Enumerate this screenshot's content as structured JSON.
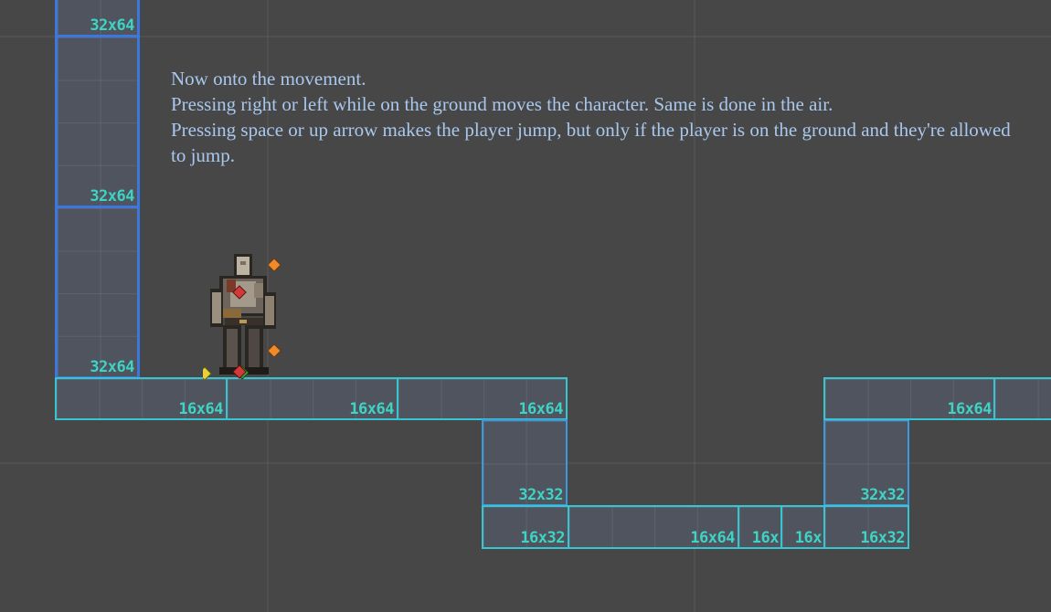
{
  "instructions": {
    "line1": "Now onto the movement.",
    "line2": "Pressing right or left while on the ground moves the character. Same is done in the air.",
    "line3": "Pressing space or up arrow makes the player jump, but only if the player is on the ground and they're allowed to jump."
  },
  "tiles": {
    "wall_top": "32x64",
    "wall_mid": "32x64",
    "wall_bot": "32x64",
    "floor_1": "16x64",
    "floor_2": "16x64",
    "floor_3": "16x64",
    "floor_4": "16x64",
    "pit_left_upper": "32x32",
    "pit_left_lower": "16x32",
    "pit_floor": "16x64",
    "pit_small_1": "16x",
    "pit_small_2": "16x",
    "pit_right_upper": "32x32",
    "pit_right_lower": "16x32"
  },
  "colors": {
    "background": "#474747",
    "wall_border": "#3a78e0",
    "floor_border": "#35c6d2",
    "label": "#3fd3c4",
    "text": "#a9c8ee"
  }
}
